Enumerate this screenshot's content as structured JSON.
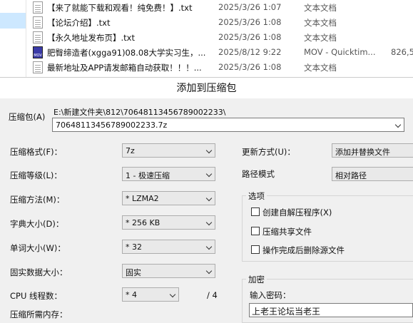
{
  "files": [
    {
      "name": "【来了就能下载和观看！纯免费！】.txt",
      "date": "2025/3/26 1:07",
      "type": "文本文档",
      "size": "",
      "icon": "txt"
    },
    {
      "name": "【论坛介绍】.txt",
      "date": "2025/3/26 1:08",
      "type": "文本文档",
      "size": "",
      "icon": "txt"
    },
    {
      "name": "【永久地址发布页】.txt",
      "date": "2025/3/26 1:08",
      "type": "文本文档",
      "size": "",
      "icon": "txt"
    },
    {
      "name": "肥臀缔造者(xgga91)08.08大学实习生，...",
      "date": "2025/8/12 9:22",
      "type": "MOV - Quicktim...",
      "size": "826,5",
      "icon": "mov"
    },
    {
      "name": "最新地址及APP请发邮箱自动获取！！！...",
      "date": "2025/3/26 1:08",
      "type": "文本文档",
      "size": "",
      "icon": "txt"
    }
  ],
  "dialog": {
    "title": "添加到压缩包",
    "archive_label": "压缩包(A)",
    "archive_path": "E:\\新建文件夹\\812\\70648113456789002233\\",
    "archive_name": "70648113456789002233.7z",
    "format_label": "压缩格式(F)：",
    "format_value": "7z",
    "level_label": "压缩等级(L)：",
    "level_value": "1 - 极速压缩",
    "method_label": "压缩方法(M)：",
    "method_value": "* LZMA2",
    "dict_label": "字典大小(D)：",
    "dict_value": "* 256 KB",
    "word_label": "单词大小(W)：",
    "word_value": "* 32",
    "solid_label": "固实数据大小：",
    "solid_value": "固实",
    "threads_label": "CPU 线程数：",
    "threads_value": "* 4",
    "threads_total": "/ 4",
    "memory_label": "压缩所需内存：",
    "update_label": "更新方式(U)：",
    "update_value": "添加并替换文件",
    "path_label": "路径模式",
    "path_value": "相对路径",
    "options_title": "选项",
    "opt_sfx": "创建自解压程序(X)",
    "opt_shared": "压缩共享文件",
    "opt_delete": "操作完成后删除源文件",
    "encrypt_title": "加密",
    "password_label": "输入密码：",
    "password_value": "上老王论坛当老王"
  }
}
